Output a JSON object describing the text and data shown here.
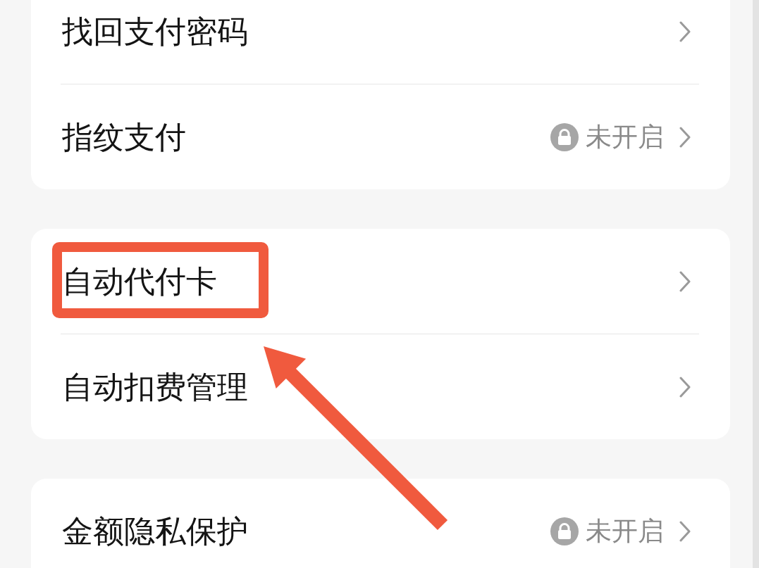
{
  "groups": [
    {
      "rows": [
        {
          "label": "找回支付密码",
          "highlighted": false
        },
        {
          "label": "指纹支付",
          "status": "未开启",
          "highlighted": false
        }
      ]
    },
    {
      "rows": [
        {
          "label": "自动代付卡",
          "highlighted": true
        },
        {
          "label": "自动扣费管理",
          "highlighted": false
        }
      ]
    },
    {
      "rows": [
        {
          "label": "金额隐私保护",
          "status": "未开启",
          "highlighted": false
        }
      ]
    }
  ]
}
